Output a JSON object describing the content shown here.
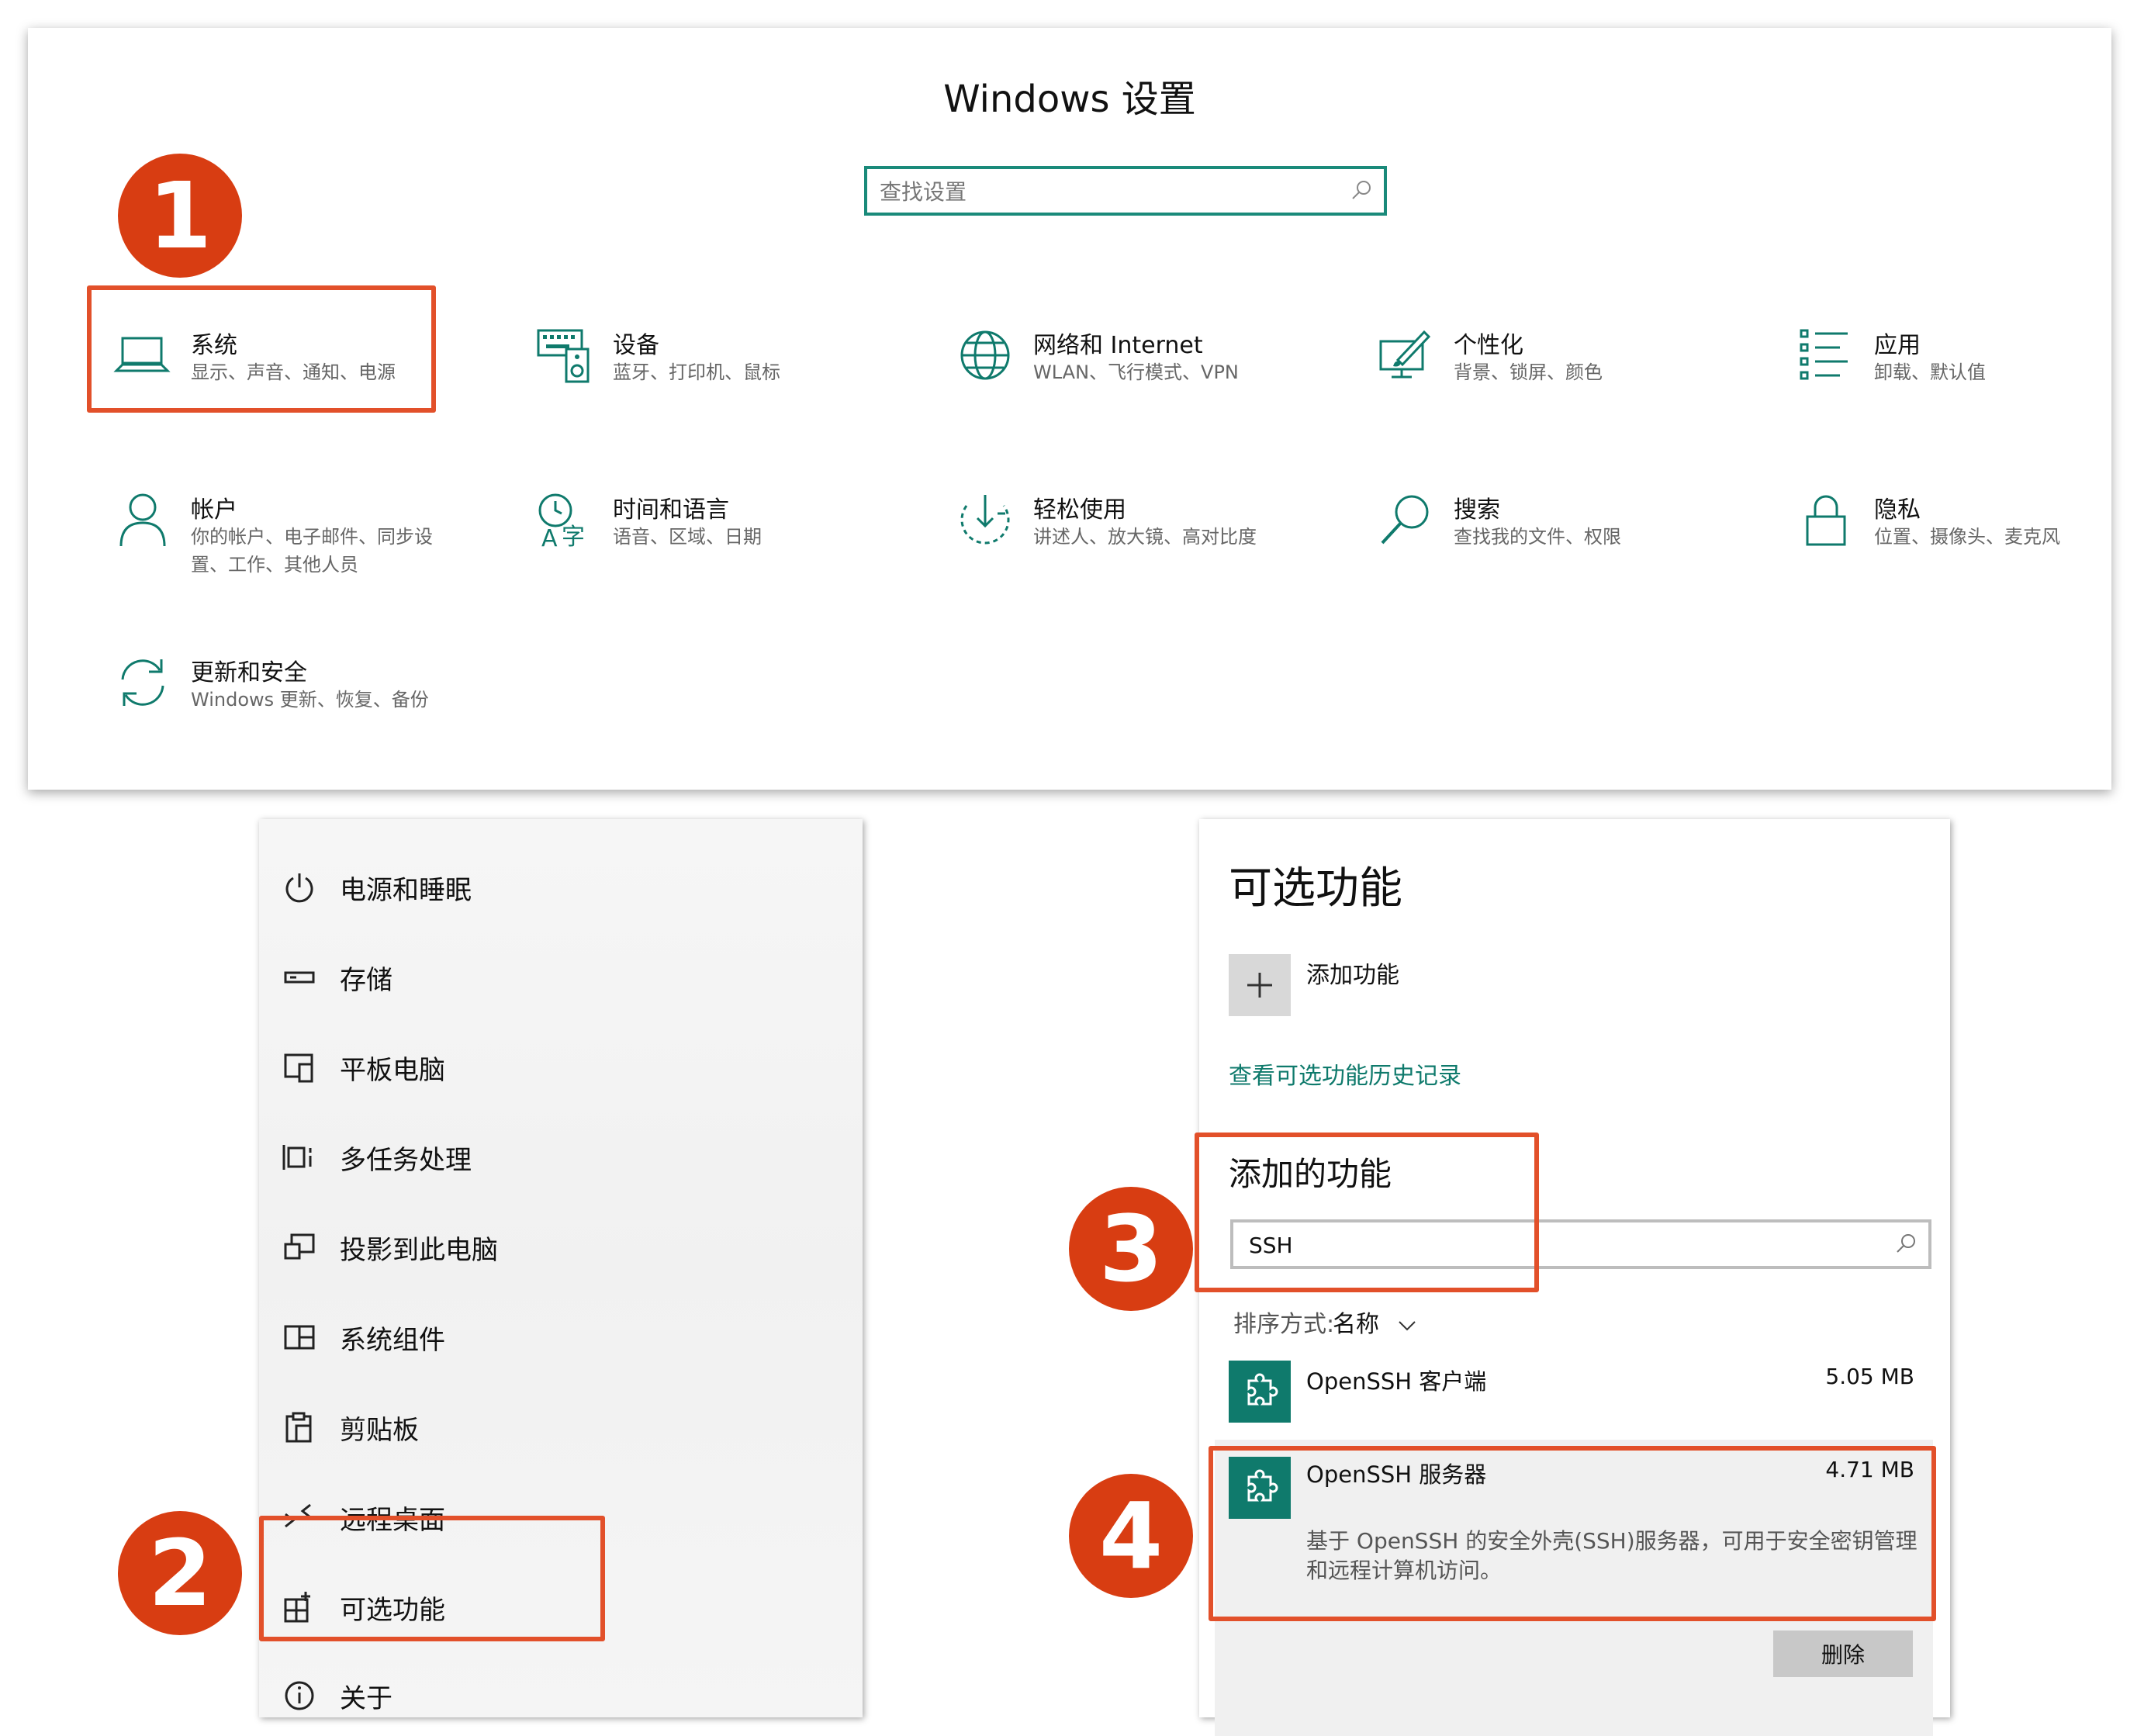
{
  "settings": {
    "title": "Windows 设置",
    "search_placeholder": "查找设置",
    "tiles": [
      {
        "title": "系统",
        "subtitle": "显示、声音、通知、电源",
        "icon": "laptop-icon"
      },
      {
        "title": "设备",
        "subtitle": "蓝牙、打印机、鼠标",
        "icon": "keyboard-speaker-icon"
      },
      {
        "title": "网络和 Internet",
        "subtitle": "WLAN、飞行模式、VPN",
        "icon": "globe-icon"
      },
      {
        "title": "个性化",
        "subtitle": "背景、锁屏、颜色",
        "icon": "paint-monitor-icon"
      },
      {
        "title": "应用",
        "subtitle": "卸载、默认值",
        "icon": "app-list-icon"
      },
      {
        "title": "帐户",
        "subtitle": "你的帐户、电子邮件、同步设置、工作、其他人员",
        "icon": "person-icon"
      },
      {
        "title": "时间和语言",
        "subtitle": "语音、区域、日期",
        "icon": "time-language-icon"
      },
      {
        "title": "轻松使用",
        "subtitle": "讲述人、放大镜、高对比度",
        "icon": "ease-of-access-icon"
      },
      {
        "title": "搜索",
        "subtitle": "查找我的文件、权限",
        "icon": "search-icon"
      },
      {
        "title": "隐私",
        "subtitle": "位置、摄像头、麦克风",
        "icon": "lock-icon"
      },
      {
        "title": "更新和安全",
        "subtitle": "Windows 更新、恢复、备份",
        "icon": "sync-icon"
      }
    ]
  },
  "steps": [
    "1",
    "2",
    "3",
    "4"
  ],
  "system_nav": [
    {
      "label": "电源和睡眠",
      "icon": "power-icon"
    },
    {
      "label": "存储",
      "icon": "storage-icon"
    },
    {
      "label": "平板电脑",
      "icon": "tablet-icon"
    },
    {
      "label": "多任务处理",
      "icon": "multitask-icon"
    },
    {
      "label": "投影到此电脑",
      "icon": "project-icon"
    },
    {
      "label": "系统组件",
      "icon": "components-icon"
    },
    {
      "label": "剪贴板",
      "icon": "clipboard-icon"
    },
    {
      "label": "远程桌面",
      "icon": "remote-desktop-icon"
    },
    {
      "label": "可选功能",
      "icon": "optional-features-icon"
    },
    {
      "label": "关于",
      "icon": "info-icon"
    }
  ],
  "optional_features": {
    "title": "可选功能",
    "add_label": "添加功能",
    "history_link": "查看可选功能历史记录",
    "added_title": "添加的功能",
    "search_value": "SSH",
    "sort_label": "排序方式:",
    "sort_value": "名称",
    "features": [
      {
        "name": "OpenSSH 客户端",
        "size": "5.05 MB"
      },
      {
        "name": "OpenSSH 服务器",
        "size": "4.71 MB",
        "description": "基于 OpenSSH 的安全外壳(SSH)服务器，可用于安全密钥管理和远程计算机访问。"
      }
    ],
    "delete_label": "删除"
  },
  "colors": {
    "accent": "#0f7a6c",
    "highlight": "#e2502a",
    "badge": "#d83d12"
  }
}
